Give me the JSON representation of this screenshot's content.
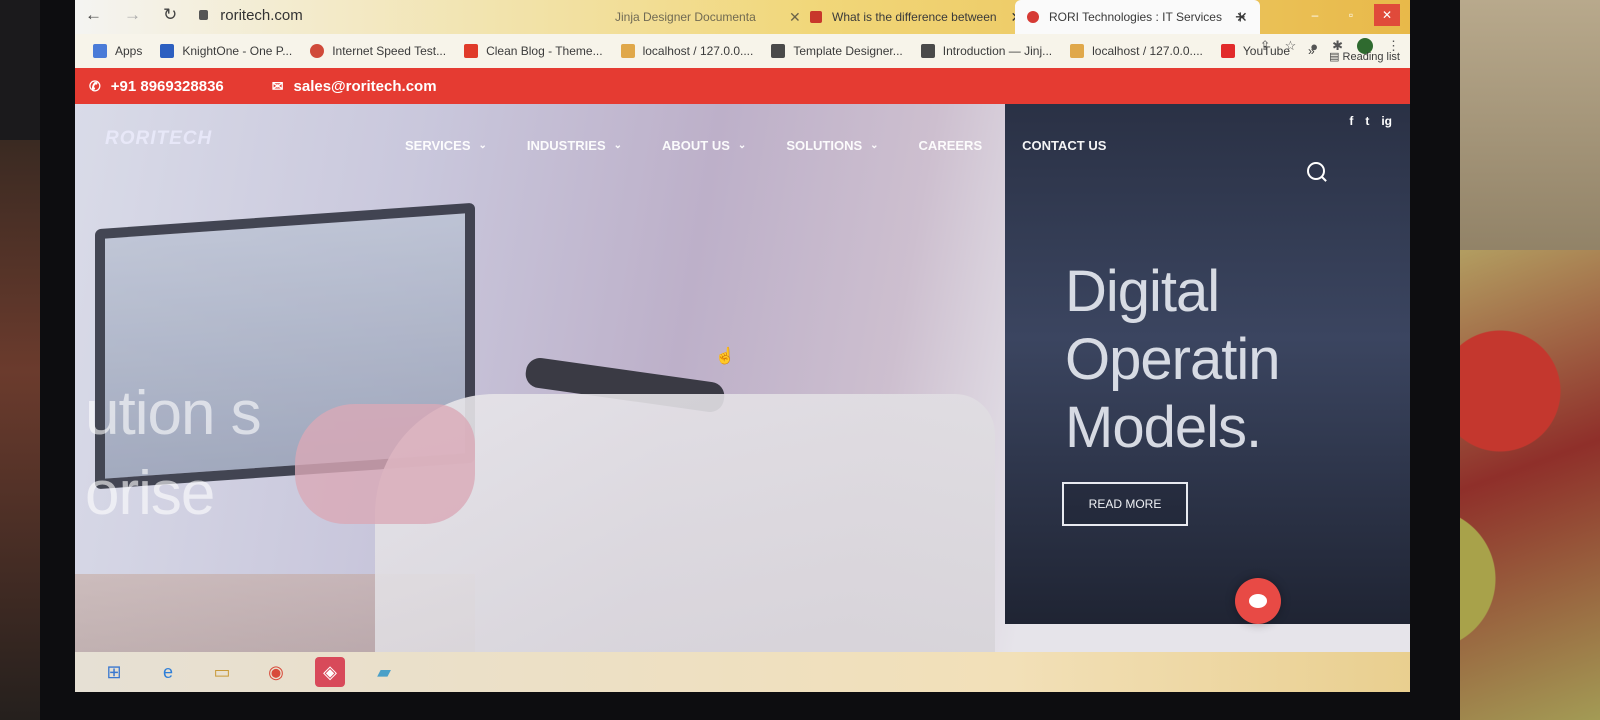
{
  "browser": {
    "tabs": [
      {
        "title": "Jinja Designer Documenta",
        "close": "✕",
        "active": false
      },
      {
        "title": "What is the difference between",
        "close": "✕",
        "active": false
      },
      {
        "title": "RORI Technologies : IT Services",
        "close": "✕",
        "active": true
      }
    ],
    "new_tab": "+",
    "address": {
      "back": "←",
      "forward": "→",
      "reload": "↻",
      "url": "roritech.com"
    },
    "bookmarks": [
      {
        "label": "Apps",
        "color": "#4a7bd8"
      },
      {
        "label": "KnightOne - One P...",
        "color": "#2c5fc0"
      },
      {
        "label": "Internet Speed Test...",
        "color": "#d04a3a"
      },
      {
        "label": "Clean Blog - Theme...",
        "color": "#e03b2a"
      },
      {
        "label": "localhost / 127.0.0....",
        "color": "#e0a84a"
      },
      {
        "label": "Template Designer...",
        "color": "#4a4a4a"
      },
      {
        "label": "Introduction — Jinj...",
        "color": "#4a4a4a"
      },
      {
        "label": "localhost / 127.0.0....",
        "color": "#e0a84a"
      },
      {
        "label": "YouTube",
        "color": "#e22b2b"
      }
    ],
    "more_bookmarks": "»",
    "reading_list": "Reading list"
  },
  "site": {
    "phone": "+91 8969328836",
    "email": "sales@roritech.com",
    "brand": "RORITECH",
    "nav": [
      {
        "label": "SERVICES",
        "dropdown": true
      },
      {
        "label": "INDUSTRIES",
        "dropdown": true
      },
      {
        "label": "ABOUT US",
        "dropdown": true
      },
      {
        "label": "SOLUTIONS",
        "dropdown": true
      },
      {
        "label": "CAREERS",
        "dropdown": false
      },
      {
        "label": "CONTACT US",
        "dropdown": false
      }
    ],
    "social": [
      "f",
      "t",
      "ig"
    ],
    "hero_left_text": [
      "ution s",
      "orise"
    ],
    "headline": [
      "Digital",
      "Operatin",
      "Models."
    ],
    "cta": "READ MORE",
    "accent_color": "#e53b32"
  }
}
